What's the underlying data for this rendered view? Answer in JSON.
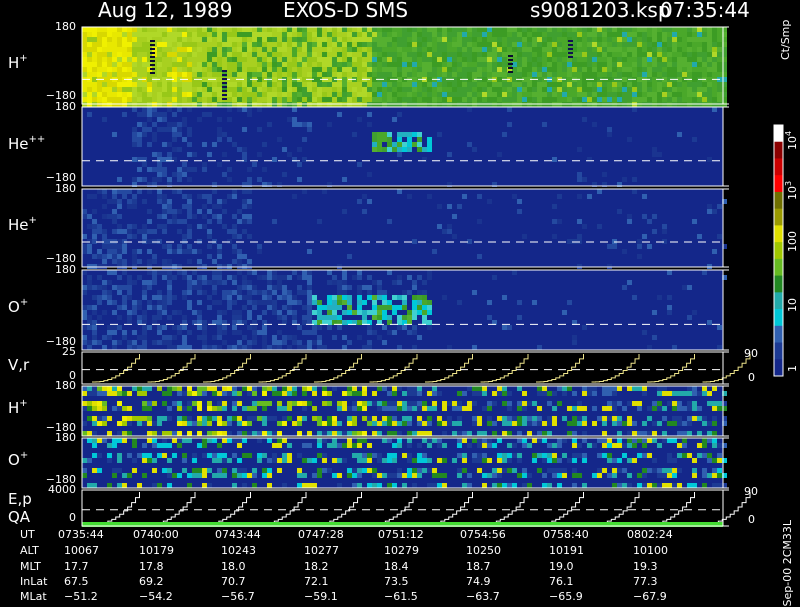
{
  "header": {
    "date": "Aug 12, 1989",
    "mission": "EXOS-D SMS",
    "file": "s9081203.ksp",
    "time": "07:35:44"
  },
  "colorbar": {
    "unit": "Ct/Smp",
    "labels": [
      "10",
      "10",
      "100",
      "10",
      "10",
      "1"
    ],
    "exponents": [
      "4",
      "3"
    ],
    "colors": [
      "#ffffff",
      "#8b0000",
      "#cc0000",
      "#ff0000",
      "#707000",
      "#9a9a00",
      "#e0e000",
      "#a0c800",
      "#66bb22",
      "#228822",
      "#22aaaa",
      "#00c8d8",
      "#3060b0",
      "#1c3a94",
      "#14278a"
    ]
  },
  "panels": [
    {
      "label": "H",
      "sup": "+",
      "ymax": "180",
      "ymin": "−180"
    },
    {
      "label": "He",
      "sup": "++",
      "ymax": "180",
      "ymin": "−180"
    },
    {
      "label": "He",
      "sup": "+",
      "ymax": "180",
      "ymin": "−180"
    },
    {
      "label": "O",
      "sup": "+",
      "ymax": "180",
      "ymin": "−180"
    },
    {
      "label": "V,r",
      "sup": "",
      "ymax": "25",
      "ymin": "0",
      "right_top": "90",
      "right_bottom": "0"
    },
    {
      "label": "H",
      "sup": "+",
      "ymax": "180",
      "ymin": "−180"
    },
    {
      "label": "O",
      "sup": "+",
      "ymax": "180",
      "ymin": "−180"
    },
    {
      "label": "E,p",
      "label2": "QA",
      "sup": "",
      "ymax": "4000",
      "ymin": "0",
      "right_top": "90",
      "right_bottom": "0"
    }
  ],
  "footer_note": "Sep-00 2CM33L",
  "table": {
    "row_labels": [
      "UT",
      "ALT",
      "MLT",
      "InLat",
      "MLat"
    ],
    "columns": [
      [
        "0735:44",
        "10067",
        "17.7",
        "67.5",
        "−51.2"
      ],
      [
        "0740:00",
        "10179",
        "17.8",
        "69.2",
        "−54.2"
      ],
      [
        "0743:44",
        "10243",
        "18.0",
        "70.7",
        "−56.7"
      ],
      [
        "0747:28",
        "10277",
        "18.2",
        "72.1",
        "−59.1"
      ],
      [
        "0751:12",
        "10279",
        "18.4",
        "73.5",
        "−61.5"
      ],
      [
        "0754:56",
        "10250",
        "18.7",
        "74.9",
        "−63.7"
      ],
      [
        "0758:40",
        "10191",
        "19.0",
        "76.1",
        "−65.9"
      ],
      [
        "0802:24",
        "10100",
        "19.3",
        "77.3",
        "−67.9"
      ]
    ]
  },
  "chart_data": {
    "type": "heatmap",
    "title": "Aug 12, 1989   EXOS-D SMS",
    "x": [
      "0735:44",
      "0740:00",
      "0743:44",
      "0747:28",
      "0751:12",
      "0754:56",
      "0758:40",
      "0802:24"
    ],
    "series": [
      {
        "name": "H+",
        "ylim": [
          -180,
          180
        ]
      },
      {
        "name": "He++",
        "ylim": [
          -180,
          180
        ]
      },
      {
        "name": "He+",
        "ylim": [
          -180,
          180
        ]
      },
      {
        "name": "O+",
        "ylim": [
          -180,
          180
        ]
      },
      {
        "name": "V,r",
        "ylim": [
          0,
          25
        ]
      },
      {
        "name": "H+",
        "ylim": [
          -180,
          180
        ]
      },
      {
        "name": "O+",
        "ylim": [
          -180,
          180
        ]
      },
      {
        "name": "E,p",
        "ylim": [
          0,
          4000
        ]
      }
    ],
    "colorbar_range": [
      1,
      10000
    ],
    "colorbar_unit": "Ct/Smp"
  }
}
